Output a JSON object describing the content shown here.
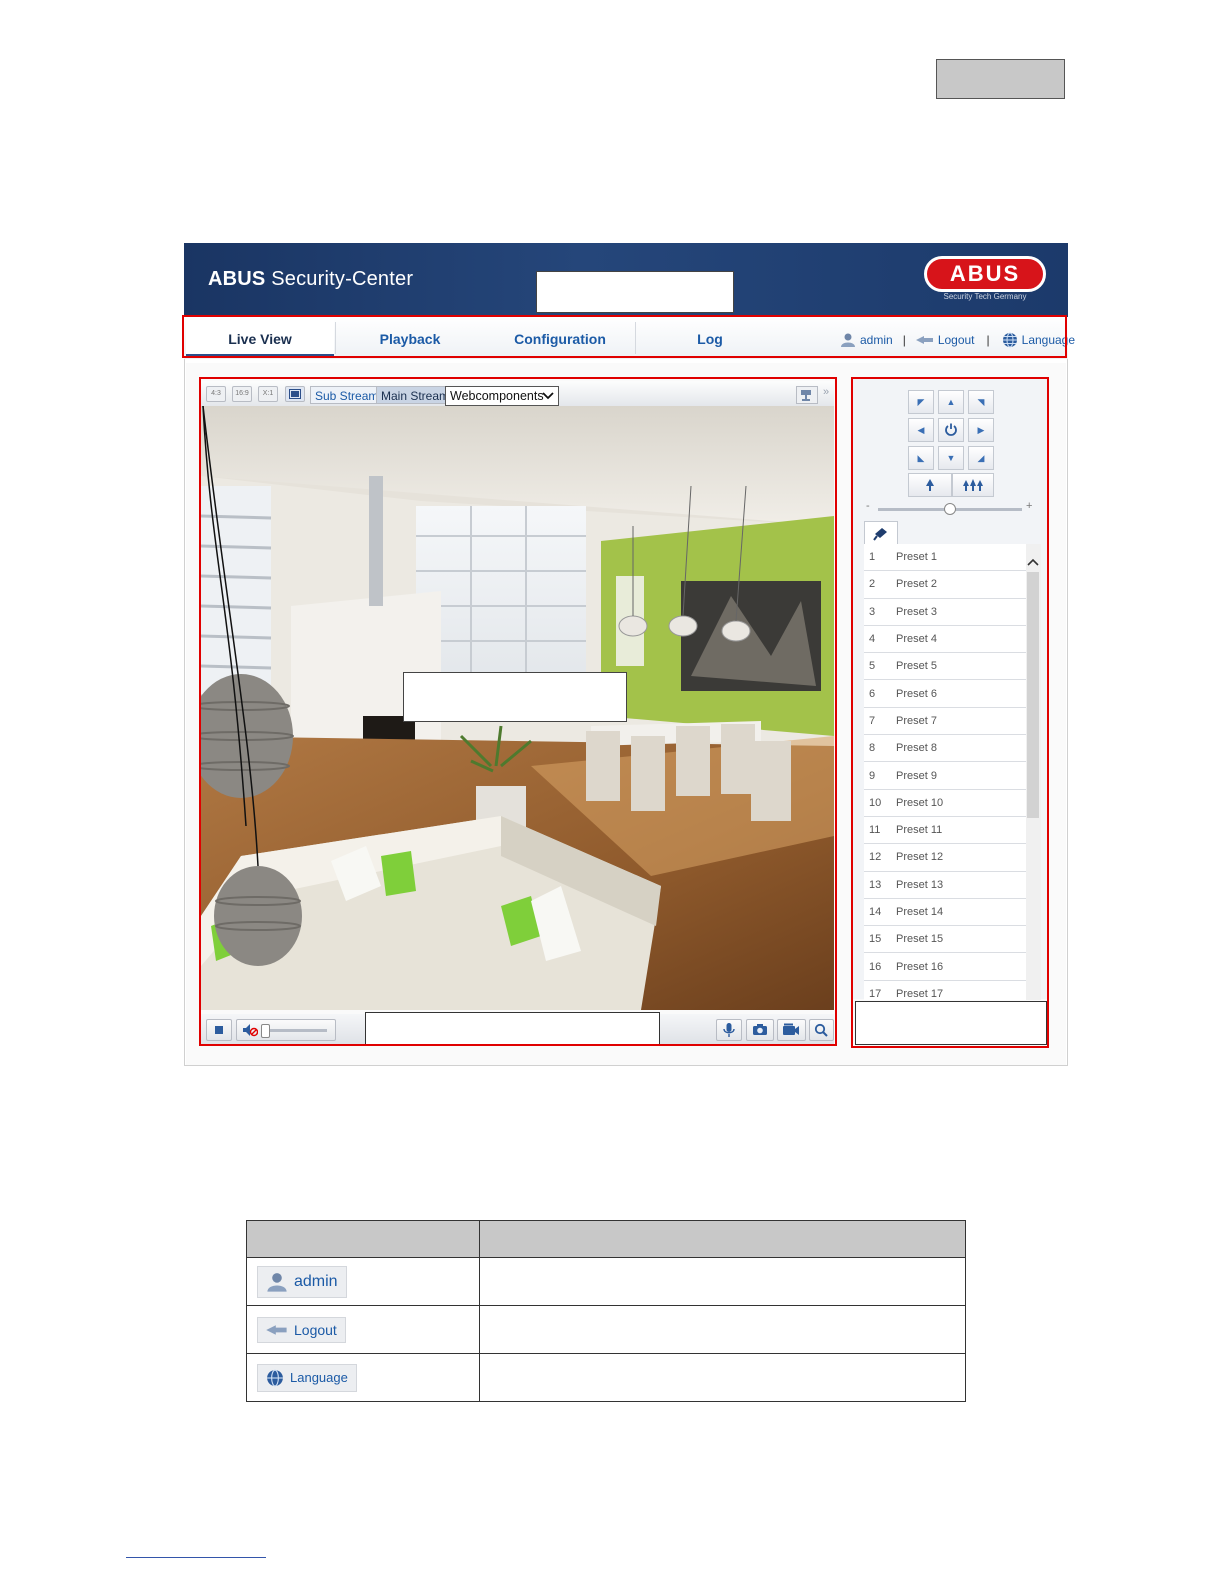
{
  "app": {
    "title_bold": "ABUS",
    "title_rest": " Security-Center",
    "logo_text": "ABUS",
    "logo_tagline": "Security Tech Germany"
  },
  "nav": {
    "tabs": [
      "Live View",
      "Playback",
      "Configuration",
      "Log"
    ],
    "active_tab": "Live View",
    "user": "admin",
    "logout": "Logout",
    "language": "Language",
    "separator": "|"
  },
  "video": {
    "sub_stream": "Sub Stream",
    "main_stream": "Main Stream",
    "plugin_select": "Webcomponents",
    "aspect_buttons": [
      "4:3",
      "16:9",
      "X:1"
    ]
  },
  "ptz": {
    "zoom_minus": "-",
    "zoom_plus": "+",
    "presets": [
      {
        "num": "1",
        "name": "Preset 1"
      },
      {
        "num": "2",
        "name": "Preset 2"
      },
      {
        "num": "3",
        "name": "Preset 3"
      },
      {
        "num": "4",
        "name": "Preset 4"
      },
      {
        "num": "5",
        "name": "Preset 5"
      },
      {
        "num": "6",
        "name": "Preset 6"
      },
      {
        "num": "7",
        "name": "Preset 7"
      },
      {
        "num": "8",
        "name": "Preset 8"
      },
      {
        "num": "9",
        "name": "Preset 9"
      },
      {
        "num": "10",
        "name": "Preset 10"
      },
      {
        "num": "11",
        "name": "Preset 11"
      },
      {
        "num": "12",
        "name": "Preset 12"
      },
      {
        "num": "13",
        "name": "Preset 13"
      },
      {
        "num": "14",
        "name": "Preset 14"
      },
      {
        "num": "15",
        "name": "Preset 15"
      },
      {
        "num": "16",
        "name": "Preset 16"
      },
      {
        "num": "17",
        "name": "Preset 17"
      }
    ]
  },
  "legend_table": {
    "rows": [
      {
        "label": "admin",
        "icon": "user-icon"
      },
      {
        "label": "Logout",
        "icon": "logout-icon"
      },
      {
        "label": "Language",
        "icon": "globe-icon"
      }
    ]
  },
  "colors": {
    "highlight": "#e00000",
    "banner": "#1f3d6e",
    "link": "#1b5aa6",
    "abus_red": "#d7141a"
  }
}
